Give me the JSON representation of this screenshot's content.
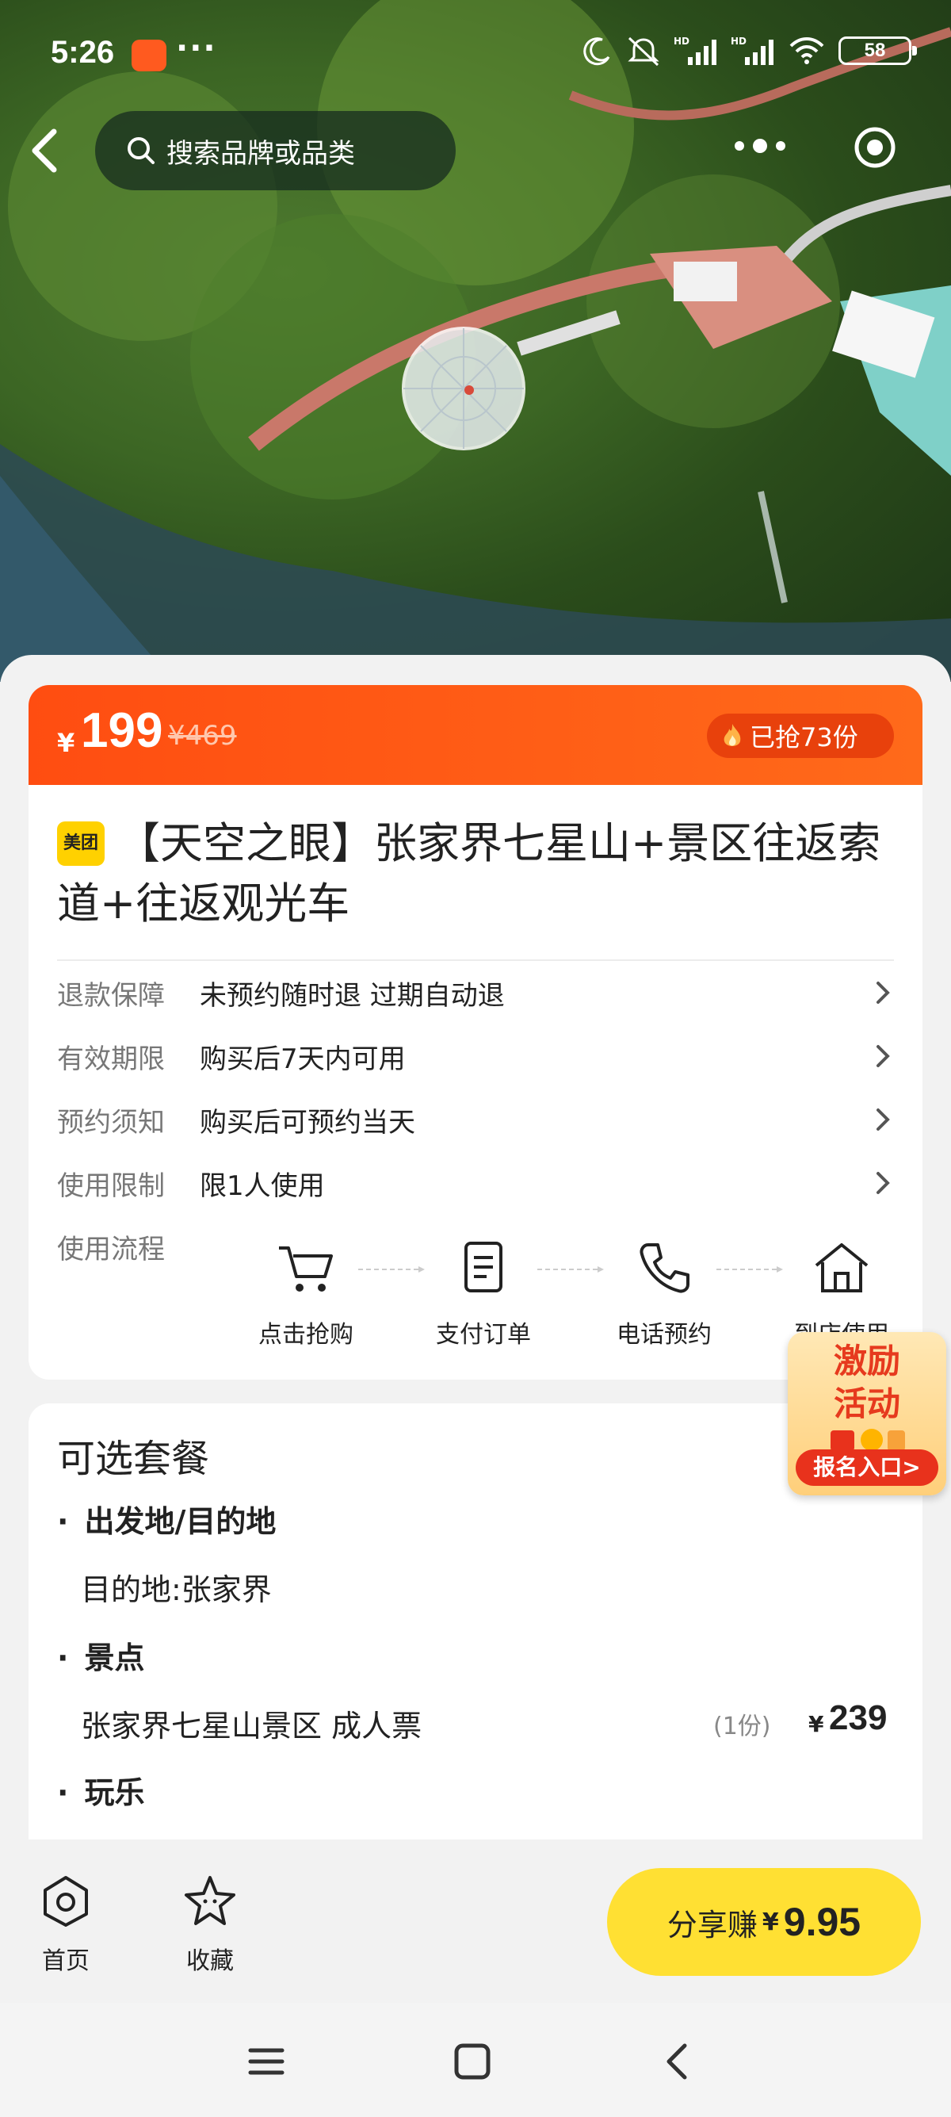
{
  "status_bar": {
    "time": "5:26",
    "overflow": "···",
    "battery": "58"
  },
  "nav": {
    "search_placeholder": "搜索品牌或品类"
  },
  "price": {
    "currency": "¥",
    "current": "199",
    "original": "¥469",
    "sold": "已抢73份"
  },
  "product": {
    "brand_badge": "美团",
    "title": "【天空之眼】张家界七星山+景区往返索道+往返观光车"
  },
  "info_rows": [
    {
      "label": "退款保障",
      "value": "未预约随时退 过期自动退"
    },
    {
      "label": "有效期限",
      "value": "购买后7天内可用"
    },
    {
      "label": "预约须知",
      "value": "购买后可预约当天"
    },
    {
      "label": "使用限制",
      "value": "限1人使用"
    }
  ],
  "flow": {
    "label": "使用流程",
    "steps": [
      {
        "icon": "cart-icon",
        "label": "点击抢购"
      },
      {
        "icon": "document-icon",
        "label": "支付订单"
      },
      {
        "icon": "phone-icon",
        "label": "电话预约"
      },
      {
        "icon": "home-icon",
        "label": "到店使用"
      }
    ]
  },
  "promo": {
    "title_line1": "激励",
    "title_line2": "活动",
    "button": "报名入口>"
  },
  "packages": {
    "title": "可选套餐",
    "section1": "出发地/目的地",
    "destination": "目的地:张家界",
    "section2": "景点",
    "ticket_name": "张家界七星山景区 成人票",
    "ticket_qty": "(1份)",
    "ticket_currency": "¥",
    "ticket_price": "239",
    "section3": "玩乐"
  },
  "bottom_bar": {
    "home_label": "首页",
    "favorite_label": "收藏",
    "share_label": "分享赚",
    "share_currency": "¥",
    "share_amount": "9.95"
  },
  "colors": {
    "accent_orange": "#ff4d11",
    "share_yellow": "#ffe033",
    "brand_yellow": "#ffd100"
  }
}
